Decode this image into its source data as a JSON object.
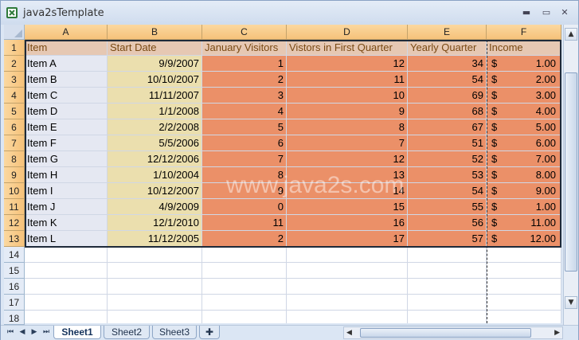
{
  "window": {
    "title": "java2sTemplate"
  },
  "watermark": "www.java2s.com",
  "columns": [
    "A",
    "B",
    "C",
    "D",
    "E",
    "F"
  ],
  "rows": [
    "1",
    "2",
    "3",
    "4",
    "5",
    "6",
    "7",
    "8",
    "9",
    "10",
    "11",
    "12",
    "13",
    "14",
    "15",
    "16",
    "17",
    "18"
  ],
  "headers": [
    "Item",
    "Start Date",
    "January Visitors",
    "Vistors in First Quarter",
    "Yearly Quarter",
    "Income"
  ],
  "data": [
    [
      "Item A",
      "9/9/2007",
      "1",
      "12",
      "34",
      "$",
      "1.00"
    ],
    [
      "Item B",
      "10/10/2007",
      "2",
      "11",
      "54",
      "$",
      "2.00"
    ],
    [
      "Item C",
      "11/11/2007",
      "3",
      "10",
      "69",
      "$",
      "3.00"
    ],
    [
      "Item D",
      "1/1/2008",
      "4",
      "9",
      "68",
      "$",
      "4.00"
    ],
    [
      "Item E",
      "2/2/2008",
      "5",
      "8",
      "67",
      "$",
      "5.00"
    ],
    [
      "Item F",
      "5/5/2006",
      "6",
      "7",
      "51",
      "$",
      "6.00"
    ],
    [
      "Item G",
      "12/12/2006",
      "7",
      "12",
      "52",
      "$",
      "7.00"
    ],
    [
      "Item H",
      "1/10/2004",
      "8",
      "13",
      "53",
      "$",
      "8.00"
    ],
    [
      "Item I",
      "10/12/2007",
      "9",
      "14",
      "54",
      "$",
      "9.00"
    ],
    [
      "Item J",
      "4/9/2009",
      "0",
      "15",
      "55",
      "$",
      "1.00"
    ],
    [
      "Item K",
      "12/1/2010",
      "11",
      "16",
      "56",
      "$",
      "11.00"
    ],
    [
      "Item L",
      "11/12/2005",
      "2",
      "17",
      "57",
      "$",
      "12.00"
    ]
  ],
  "sheets": [
    "Sheet1",
    "Sheet2",
    "Sheet3"
  ],
  "active_sheet": "Sheet1",
  "colors": {
    "item_column": "#e5e8f2",
    "date_column": "#ebdfae",
    "value_columns": "#eb9068",
    "header_row": "#e6c8b3"
  }
}
